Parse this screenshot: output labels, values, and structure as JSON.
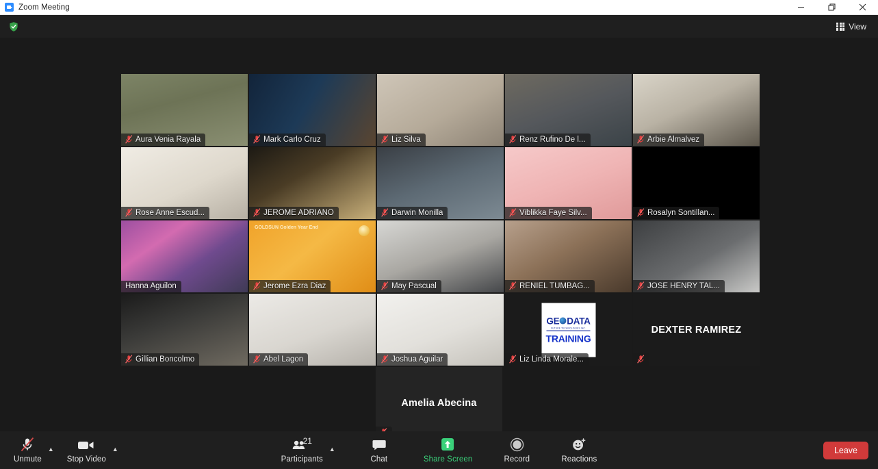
{
  "window": {
    "title": "Zoom Meeting",
    "app_icon": "zoom-icon",
    "minimize_label": "Minimize",
    "restore_label": "Restore",
    "close_label": "Close"
  },
  "topbar": {
    "security_icon": "shield-check-icon",
    "view_label": "View",
    "view_icon": "grid-icon"
  },
  "gallery": {
    "rows": [
      [
        {
          "name": "Aura Venia Rayala",
          "muted": true,
          "speaking": false,
          "video": true,
          "bg": "linear-gradient(165deg,#7d8466 0%,#6d7356 40%,#8a8f72 100%)",
          "subject": "woman-red-shirt"
        },
        {
          "name": "Mark Carlo Cruz",
          "muted": true,
          "speaking": false,
          "video": true,
          "bg": "linear-gradient(120deg,#12243a 0%,#1d3a57 45%,#5a4530 100%)",
          "subject": "man-glasses-library"
        },
        {
          "name": "Liz Silva",
          "muted": true,
          "speaking": false,
          "video": true,
          "bg": "linear-gradient(150deg,#cfc6b8 0%,#b5aa99 55%,#8d8375 100%)",
          "subject": "woman-headphones"
        },
        {
          "name": "Renz Rufino De l...",
          "muted": true,
          "speaking": false,
          "video": true,
          "bg": "linear-gradient(160deg,#6e6a60 0%,#55585c 50%,#3b4348 100%)",
          "subject": "man-glasses"
        },
        {
          "name": "Arbie Almalvez",
          "muted": true,
          "speaking": false,
          "video": true,
          "bg": "linear-gradient(155deg,#d9d4c8 0%,#b9b2a4 45%,#5d574c 100%)",
          "subject": "man-white-wall"
        }
      ],
      [
        {
          "name": "Rose Anne Escud...",
          "muted": true,
          "speaking": false,
          "video": true,
          "bg": "linear-gradient(155deg,#f0ece4 0%,#ded8cc 55%,#b6afa3 100%)",
          "subject": "woman-bright-room"
        },
        {
          "name": "JEROME ADRIANO",
          "muted": true,
          "speaking": false,
          "video": true,
          "bg": "linear-gradient(150deg,#1d1a14 0%,#4a3c25 40%,#c9b07a 100%)",
          "subject": "man-indoor"
        },
        {
          "name": "Darwin Monilla",
          "muted": true,
          "speaking": false,
          "video": true,
          "bg": "linear-gradient(160deg,#3a3f45 0%,#5d6a74 50%,#7d8a93 100%)",
          "subject": "man-blue-shirt"
        },
        {
          "name": "Viblikka Faye Silv...",
          "muted": true,
          "speaking": false,
          "video": true,
          "bg": "linear-gradient(160deg,#f6c9c9 0%,#efb4b4 50%,#e09a9a 100%)",
          "subject": "woman-pink-background"
        },
        {
          "name": "Rosalyn Sontillan...",
          "muted": true,
          "speaking": false,
          "video": true,
          "bg": "#000000",
          "subject": "dark-camera"
        }
      ],
      [
        {
          "name": "Hanna Aguilon",
          "muted": false,
          "speaking": true,
          "video": true,
          "bg": "linear-gradient(145deg,#9c4fa0 0%,#d36bb0 30%,#6f4a8e 60%,#3f3a55 100%)",
          "subject": "woman-cherry-blossom-background"
        },
        {
          "name": "Jerome Ezra Diaz",
          "muted": true,
          "speaking": false,
          "video": true,
          "bg": "linear-gradient(140deg,#f0a32a 0%,#f5b945 45%,#e08d16 100%)",
          "subject": "man-goldsun-background",
          "overlay_text": "GOLDSUN Golden Year End"
        },
        {
          "name": "May Pascual",
          "muted": true,
          "speaking": false,
          "video": true,
          "bg": "linear-gradient(160deg,#d7d7d4 0%,#a9a7a2 50%,#45474a 100%)",
          "subject": "woman-indoor"
        },
        {
          "name": "RENIEL TUMBAG...",
          "muted": true,
          "speaking": false,
          "video": true,
          "bg": "linear-gradient(150deg,#b7a08c 0%,#8c7158 45%,#4a3a2c 100%)",
          "subject": "man-indoor"
        },
        {
          "name": "JOSE HENRY TAL...",
          "muted": true,
          "speaking": false,
          "video": true,
          "bg": "linear-gradient(150deg,#3d3f41 0%,#6b6d6f 55%,#c9c9c7 100%)",
          "subject": "man-gray-shirt"
        }
      ],
      [
        {
          "name": "Gillian Boncolmo",
          "muted": true,
          "speaking": false,
          "video": true,
          "bg": "linear-gradient(160deg,#1b1b1b 0%,#3a3a38 40%,#6f6a60 100%)",
          "subject": "woman-dark-room"
        },
        {
          "name": "Abel Lagon",
          "muted": true,
          "speaking": false,
          "video": true,
          "bg": "linear-gradient(160deg,#eceae6 0%,#d9d6d0 55%,#b6b2ab 100%)",
          "subject": "man-mask-white-shirt"
        },
        {
          "name": "Joshua Aguilar",
          "muted": true,
          "speaking": false,
          "video": true,
          "bg": "linear-gradient(160deg,#f2f1ee 0%,#e2e0db 55%,#c5c2bb 100%)",
          "subject": "man-glasses-white-wall"
        },
        {
          "name": "Liz Linda Morale...",
          "muted": true,
          "speaking": false,
          "video": false,
          "bg": "#1b1b1b",
          "avatar": "geodata-training-logo",
          "logo": {
            "top": "GE DATA",
            "sub": "FUTURE TECHNOLOGIES INC.",
            "bottom": "TRAINING"
          }
        },
        {
          "name": "DEXTER RAMIREZ",
          "muted": true,
          "speaking": false,
          "video": false,
          "bg": "#1b1b1b",
          "name_centered": true
        }
      ],
      [
        {
          "name": "Amelia Abecina",
          "muted": true,
          "speaking": false,
          "video": false,
          "bg": "#242424",
          "name_centered": true
        }
      ]
    ]
  },
  "toolbar": {
    "mute": {
      "label": "Unmute",
      "icon": "mic-muted-icon",
      "caret": "audio-options-caret"
    },
    "video": {
      "label": "Stop Video",
      "icon": "video-camera-icon",
      "caret": "video-options-caret"
    },
    "participants": {
      "label": "Participants",
      "count": "21",
      "icon": "participants-icon",
      "caret": "participants-caret"
    },
    "chat": {
      "label": "Chat",
      "icon": "chat-bubble-icon"
    },
    "share": {
      "label": "Share Screen",
      "icon": "share-screen-icon",
      "color": "#3ad17a"
    },
    "record": {
      "label": "Record",
      "icon": "record-circle-icon"
    },
    "reactions": {
      "label": "Reactions",
      "icon": "reactions-smiley-icon"
    },
    "leave": {
      "label": "Leave",
      "color": "#d13a3a"
    }
  }
}
